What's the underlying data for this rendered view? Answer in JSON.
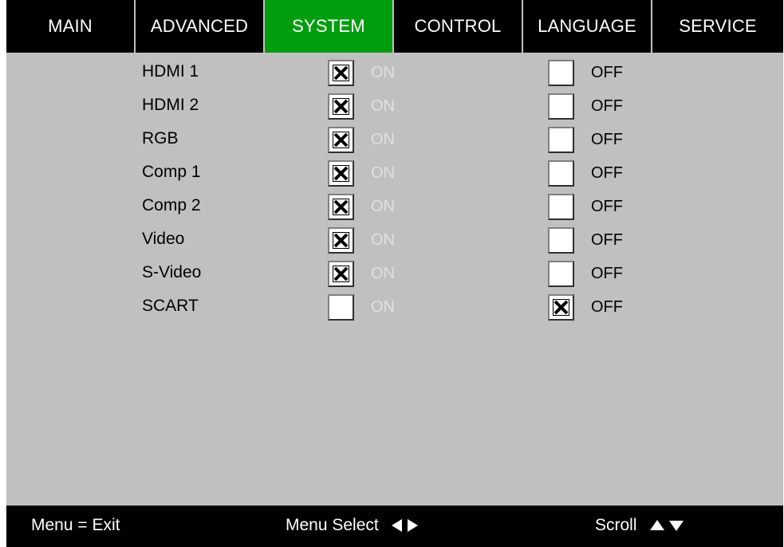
{
  "tabs": [
    {
      "label": "MAIN",
      "active": false
    },
    {
      "label": "ADVANCED",
      "active": false
    },
    {
      "label": "SYSTEM",
      "active": true
    },
    {
      "label": "CONTROL",
      "active": false
    },
    {
      "label": "LANGUAGE",
      "active": false
    },
    {
      "label": "SERVICE",
      "active": false
    }
  ],
  "sources": [
    {
      "label": "HDMI 1",
      "on_checked": true,
      "off_checked": false
    },
    {
      "label": "HDMI 2",
      "on_checked": true,
      "off_checked": false
    },
    {
      "label": "RGB",
      "on_checked": true,
      "off_checked": false
    },
    {
      "label": "Comp 1",
      "on_checked": true,
      "off_checked": false
    },
    {
      "label": "Comp 2",
      "on_checked": true,
      "off_checked": false
    },
    {
      "label": "Video",
      "on_checked": true,
      "off_checked": false
    },
    {
      "label": "S-Video",
      "on_checked": true,
      "off_checked": false
    },
    {
      "label": "SCART",
      "on_checked": false,
      "off_checked": true
    }
  ],
  "options": {
    "on_label": "ON",
    "off_label": "OFF"
  },
  "footer": {
    "exit_label": "Menu = Exit",
    "select_label": "Menu Select",
    "scroll_label": "Scroll"
  },
  "icons": {
    "select_arrows": [
      "arrow-left-icon",
      "arrow-right-icon"
    ],
    "scroll_arrows": [
      "arrow-up-icon",
      "arrow-down-icon"
    ],
    "checkbox_mark": "x-mark-icon"
  },
  "colors": {
    "active_tab": "#009e0f",
    "panel": "#c0c0c0",
    "bar": "#000000",
    "disabled_text": "#e0e0e0"
  }
}
